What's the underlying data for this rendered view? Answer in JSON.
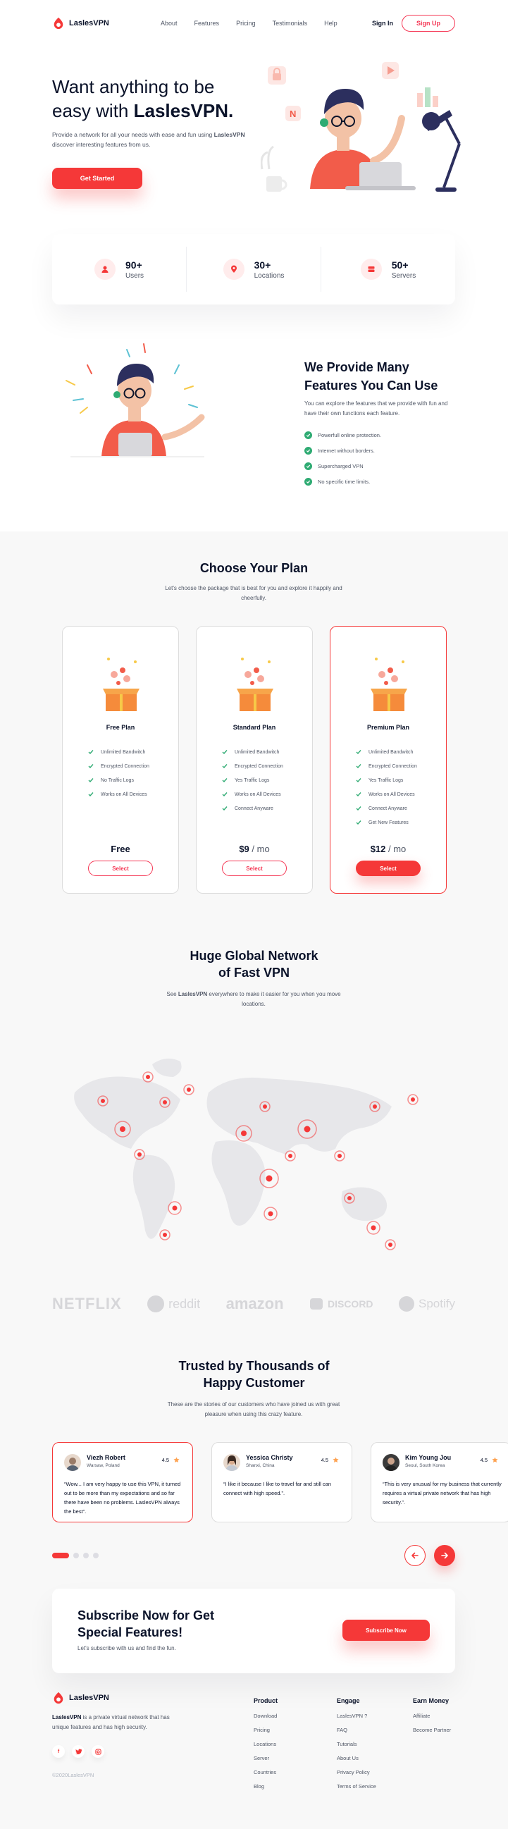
{
  "brand": {
    "name": "LaslesVPN",
    "accent": "#f53838",
    "success": "#2fab73"
  },
  "nav": {
    "links": [
      "About",
      "Features",
      "Pricing",
      "Testimonials",
      "Help"
    ],
    "signin": "Sign In",
    "signup": "Sign Up"
  },
  "hero": {
    "title_line1": "Want anything to be",
    "title_line2_pre": "easy with ",
    "title_line2_bold": "LaslesVPN.",
    "desc_pre": "Provide a network for all your needs with ease and fun using ",
    "desc_bold": "LaslesVPN",
    "desc_post": " discover interesting features from us.",
    "cta": "Get Started"
  },
  "stats": [
    {
      "icon": "user-icon",
      "value": "90+",
      "label": "Users"
    },
    {
      "icon": "location-pin-icon",
      "value": "30+",
      "label": "Locations"
    },
    {
      "icon": "server-icon",
      "value": "50+",
      "label": "Servers"
    }
  ],
  "features": {
    "title": "We Provide Many Features You Can Use",
    "desc": "You can explore the features that we provide with fun and have their own functions each feature.",
    "items": [
      "Powerfull online protection.",
      "Internet without borders.",
      "Supercharged VPN",
      "No specific time limits."
    ]
  },
  "pricing": {
    "title": "Choose Your Plan",
    "desc": "Let's choose the package that is best for you and explore it happily and cheerfully.",
    "plans": [
      {
        "name": "Free Plan",
        "features": [
          "Unlimited Bandwitch",
          "Encrypted Connection",
          "No Traffic Logs",
          "Works on All Devices"
        ],
        "price": "Free",
        "per": "",
        "button": "Select",
        "active": false
      },
      {
        "name": "Standard Plan",
        "features": [
          "Unlimited Bandwitch",
          "Encrypted Connection",
          "Yes Traffic Logs",
          "Works on All Devices",
          "Connect Anyware"
        ],
        "price": "$9",
        "per": " / mo",
        "button": "Select",
        "active": false
      },
      {
        "name": "Premium Plan",
        "features": [
          "Unlimited Bandwitch",
          "Encrypted Connection",
          "Yes Traffic Logs",
          "Works on All Devices",
          "Connect Anyware",
          "Get New Features"
        ],
        "price": "$12",
        "per": " / mo",
        "button": "Select",
        "active": true
      }
    ]
  },
  "network": {
    "title_line1": "Huge Global Network",
    "title_line2": "of Fast VPN",
    "desc_pre": "See ",
    "desc_bold": "LaslesVPN",
    "desc_post": " everywhere to make it easier for you when you move locations."
  },
  "brands": [
    "NETFLIX",
    "reddit",
    "amazon",
    "DISCORD",
    "Spotify"
  ],
  "testimonials": {
    "title_line1": "Trusted by Thousands of",
    "title_line2": "Happy Customer",
    "desc": "These are the stories of our customers who have joined us with great pleasure when using this crazy feature.",
    "items": [
      {
        "name": "Viezh Robert",
        "location": "Warsaw, Poland",
        "rating": "4.5",
        "text": "“Wow... I am very happy to use this VPN, it turned out to be more than my expectations and so far there have been no problems. LaslesVPN always the best”."
      },
      {
        "name": "Yessica Christy",
        "location": "Shanxi, China",
        "rating": "4.5",
        "text": "“I like it because I like to travel far and still can connect with high speed.”."
      },
      {
        "name": "Kim Young Jou",
        "location": "Seoul, South Korea",
        "rating": "4.5",
        "text": "“This is very unusual for my business that currently requires a virtual private network that has high security.”."
      }
    ]
  },
  "subscribe": {
    "title": "Subscribe Now for Get Special Features!",
    "desc": "Let's subscribe with us and find the fun.",
    "button": "Subscribe Now"
  },
  "footer": {
    "desc_bold": "LaslesVPN",
    "desc_rest": " is a private virtual network that has unique features and has high security.",
    "copyright": "©2020LaslesVPN",
    "columns": [
      {
        "title": "Product",
        "links": [
          "Download",
          "Pricing",
          "Locations",
          "Server",
          "Countries",
          "Blog"
        ]
      },
      {
        "title": "Engage",
        "links": [
          "LaslesVPN ?",
          "FAQ",
          "Tutorials",
          "About Us",
          "Privacy Policy",
          "Terms of Service"
        ]
      },
      {
        "title": "Earn Money",
        "links": [
          "Affiliate",
          "Become Partner"
        ]
      }
    ]
  }
}
